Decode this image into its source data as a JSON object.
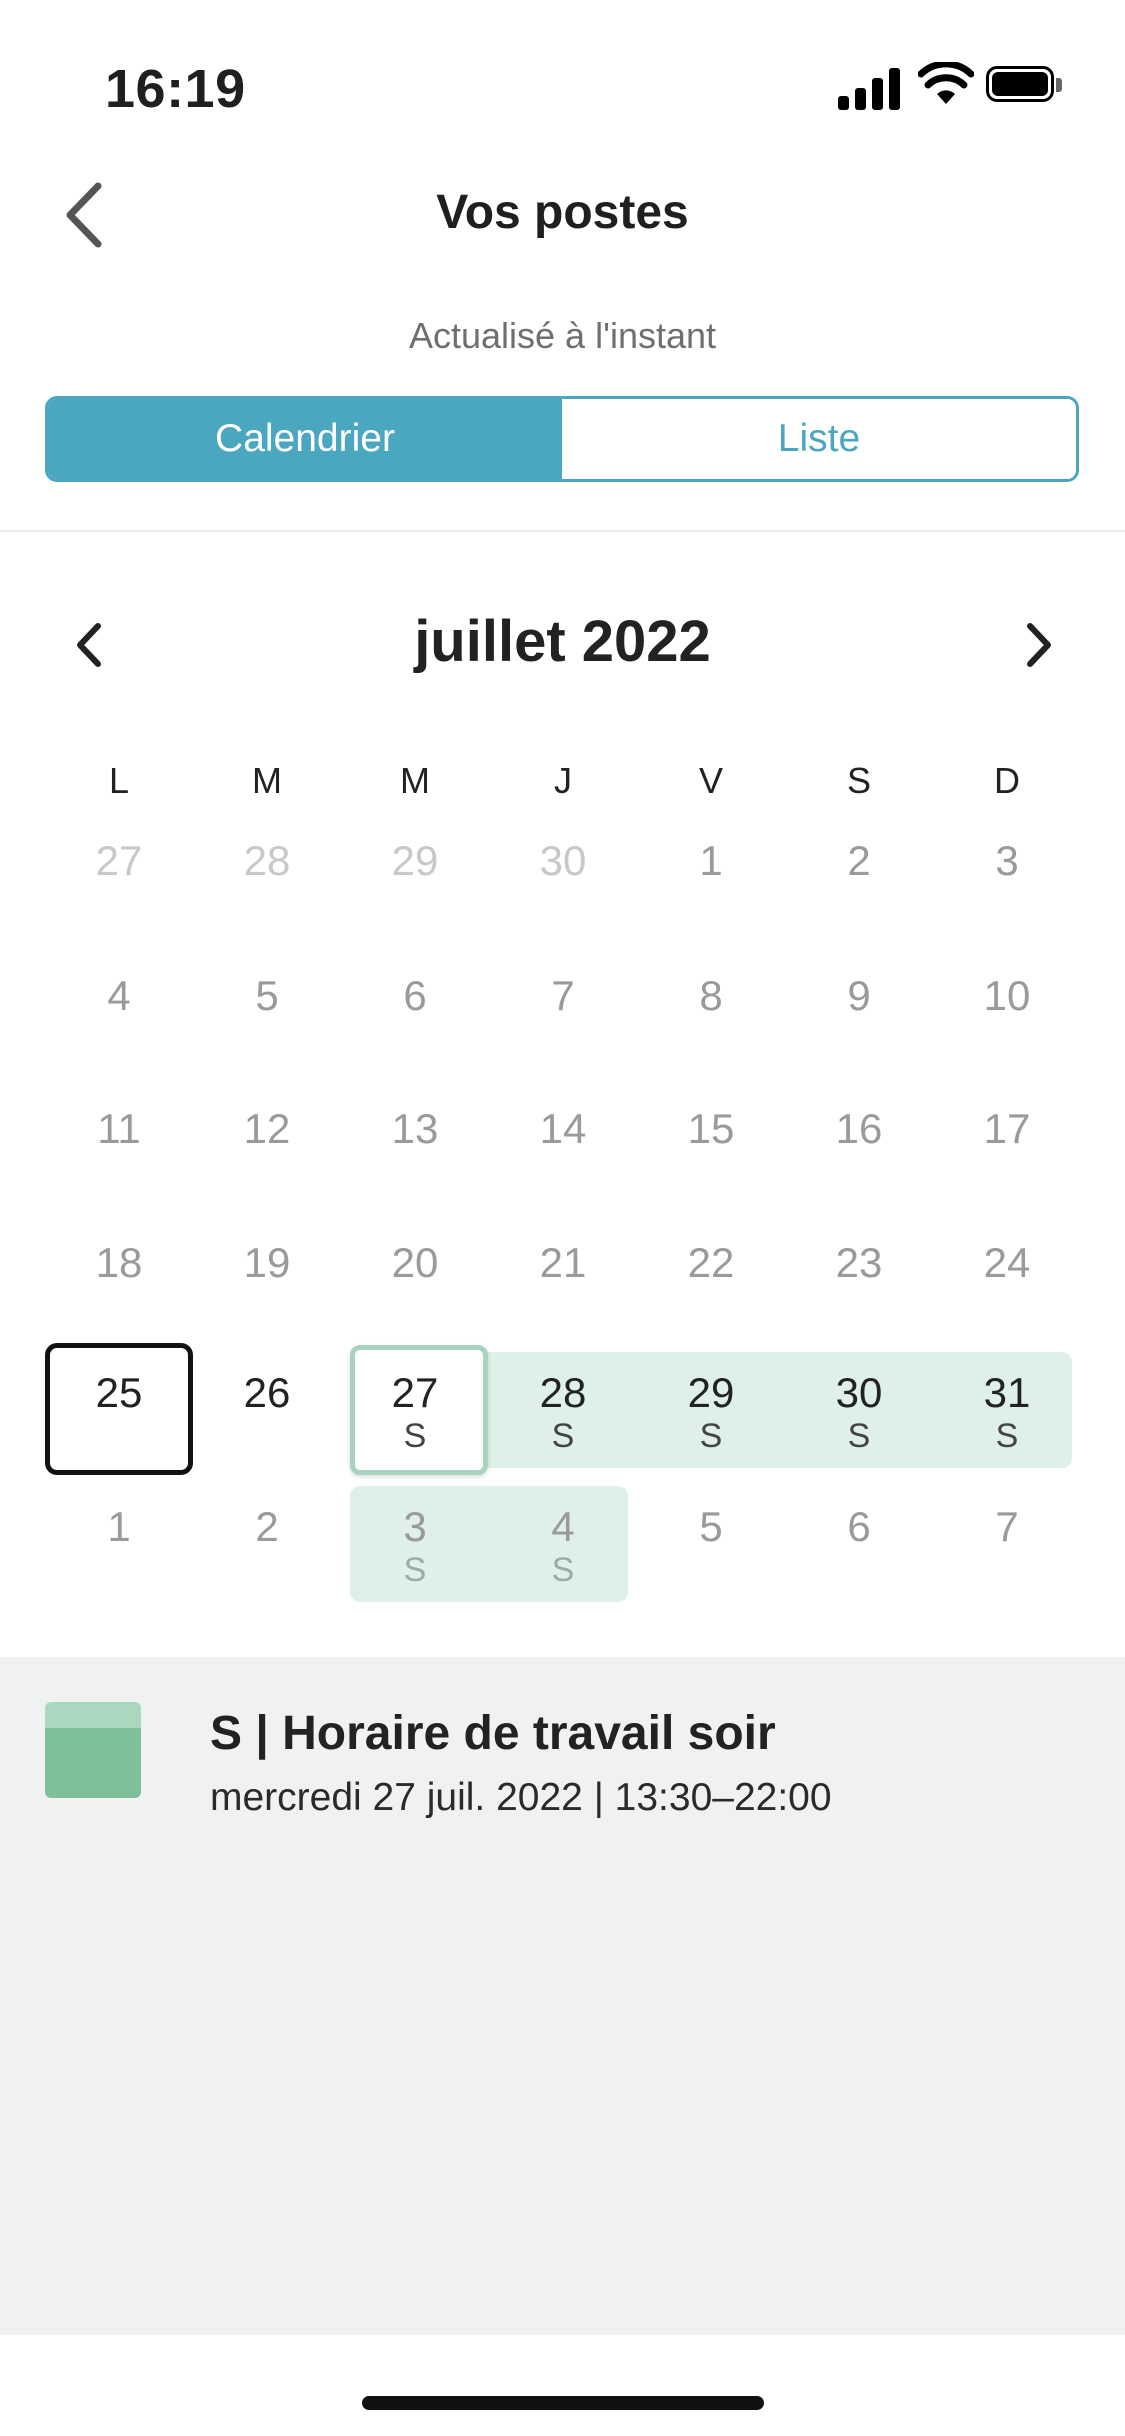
{
  "status_bar": {
    "time": "16:19"
  },
  "header": {
    "title": "Vos postes",
    "updated": "Actualisé à l'instant"
  },
  "tabs": [
    {
      "label": "Calendrier",
      "active": true
    },
    {
      "label": "Liste",
      "active": false
    }
  ],
  "colors": {
    "accent": "#4aa7bf",
    "shift_band": "#dff0e8",
    "shift_swatch": "#7fbf9a"
  },
  "calendar": {
    "month_label": "juillet 2022",
    "weekdays": [
      "L",
      "M",
      "M",
      "J",
      "V",
      "S",
      "D"
    ],
    "weeks": [
      [
        {
          "day": "27",
          "style": "prev"
        },
        {
          "day": "28",
          "style": "prev"
        },
        {
          "day": "29",
          "style": "prev"
        },
        {
          "day": "30",
          "style": "prev"
        },
        {
          "day": "1",
          "style": "norm"
        },
        {
          "day": "2",
          "style": "norm"
        },
        {
          "day": "3",
          "style": "norm"
        }
      ],
      [
        {
          "day": "4",
          "style": "norm"
        },
        {
          "day": "5",
          "style": "norm"
        },
        {
          "day": "6",
          "style": "norm"
        },
        {
          "day": "7",
          "style": "norm"
        },
        {
          "day": "8",
          "style": "norm"
        },
        {
          "day": "9",
          "style": "norm"
        },
        {
          "day": "10",
          "style": "norm"
        }
      ],
      [
        {
          "day": "11",
          "style": "norm"
        },
        {
          "day": "12",
          "style": "norm"
        },
        {
          "day": "13",
          "style": "norm"
        },
        {
          "day": "14",
          "style": "norm"
        },
        {
          "day": "15",
          "style": "norm"
        },
        {
          "day": "16",
          "style": "norm"
        },
        {
          "day": "17",
          "style": "norm"
        }
      ],
      [
        {
          "day": "18",
          "style": "norm"
        },
        {
          "day": "19",
          "style": "norm"
        },
        {
          "day": "20",
          "style": "norm"
        },
        {
          "day": "21",
          "style": "norm"
        },
        {
          "day": "22",
          "style": "norm"
        },
        {
          "day": "23",
          "style": "norm"
        },
        {
          "day": "24",
          "style": "norm"
        }
      ],
      [
        {
          "day": "25",
          "style": "dark",
          "today": true
        },
        {
          "day": "26",
          "style": "dark"
        },
        {
          "day": "27",
          "style": "dark",
          "shift": "S",
          "selected": true
        },
        {
          "day": "28",
          "style": "dark",
          "shift": "S"
        },
        {
          "day": "29",
          "style": "dark",
          "shift": "S"
        },
        {
          "day": "30",
          "style": "dark",
          "shift": "S"
        },
        {
          "day": "31",
          "style": "dark",
          "shift": "S"
        }
      ],
      [
        {
          "day": "1",
          "style": "norm"
        },
        {
          "day": "2",
          "style": "norm"
        },
        {
          "day": "3",
          "style": "norm",
          "shift": "S"
        },
        {
          "day": "4",
          "style": "norm",
          "shift": "S"
        },
        {
          "day": "5",
          "style": "norm"
        },
        {
          "day": "6",
          "style": "norm"
        },
        {
          "day": "7",
          "style": "norm"
        }
      ]
    ]
  },
  "event": {
    "title": "S | Horaire de travail soir",
    "subtitle": "mercredi 27 juil. 2022 | 13:30–22:00"
  }
}
